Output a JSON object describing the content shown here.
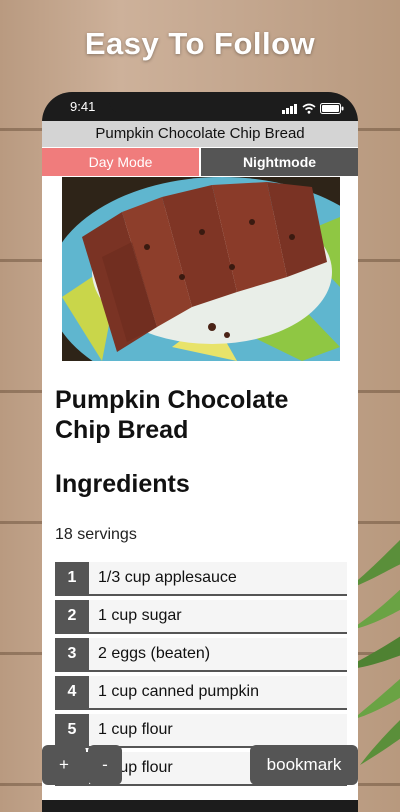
{
  "banner": {
    "text": "Easy To Follow"
  },
  "status": {
    "time": "9:41"
  },
  "app": {
    "title": "Pumpkin Chocolate Chip Bread"
  },
  "modes": {
    "day": "Day Mode",
    "night": "Nightmode"
  },
  "recipe": {
    "title": "Pumpkin Chocolate Chip Bread",
    "ingredients_heading": "Ingredients",
    "servings": "18 servings",
    "ingredients": [
      {
        "num": "1",
        "text": "1/3 cup applesauce"
      },
      {
        "num": "2",
        "text": "1 cup sugar"
      },
      {
        "num": "3",
        "text": "2 eggs (beaten)"
      },
      {
        "num": "4",
        "text": "1 cup canned pumpkin"
      },
      {
        "num": "5",
        "text": "1 cup flour"
      },
      {
        "num": "6",
        "text": "1 cup flour"
      }
    ]
  },
  "controls": {
    "zoom_in": "+",
    "zoom_out": "-",
    "bookmark": "bookmark"
  },
  "colors": {
    "day_mode": "#f07c7c",
    "dark": "#555555",
    "title_bar": "#d4d4d4"
  }
}
